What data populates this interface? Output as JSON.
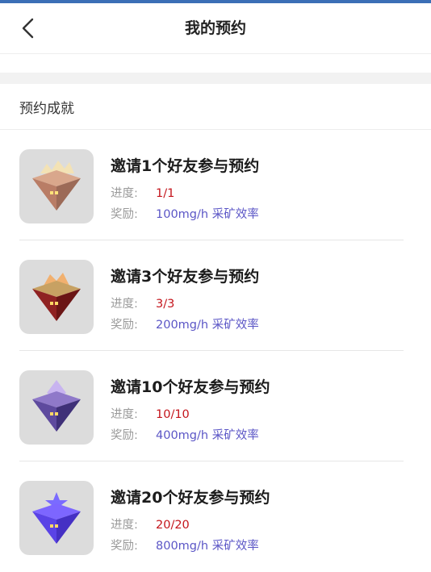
{
  "nav": {
    "title": "我的预约"
  },
  "section": {
    "title": "预约成就"
  },
  "items": [
    {
      "title": "邀请1个好友参与预约",
      "progress_label": "进度:",
      "progress": "1/1",
      "reward_label": "奖励:",
      "reward": "100mg/h 采矿效率",
      "icon": "house-crystal-tier1-icon"
    },
    {
      "title": "邀请3个好友参与预约",
      "progress_label": "进度:",
      "progress": "3/3",
      "reward_label": "奖励:",
      "reward": "200mg/h 采矿效率",
      "icon": "house-crystal-tier2-icon"
    },
    {
      "title": "邀请10个好友参与预约",
      "progress_label": "进度:",
      "progress": "10/10",
      "reward_label": "奖励:",
      "reward": "400mg/h 采矿效率",
      "icon": "house-crystal-tier3-icon"
    },
    {
      "title": "邀请20个好友参与预约",
      "progress_label": "进度:",
      "progress": "20/20",
      "reward_label": "奖励:",
      "reward": "800mg/h 采矿效率",
      "icon": "house-crystal-tier4-icon"
    }
  ],
  "colors": {
    "progress": "#c4141b",
    "reward": "#5b56c6",
    "label": "#9a9a9a"
  }
}
